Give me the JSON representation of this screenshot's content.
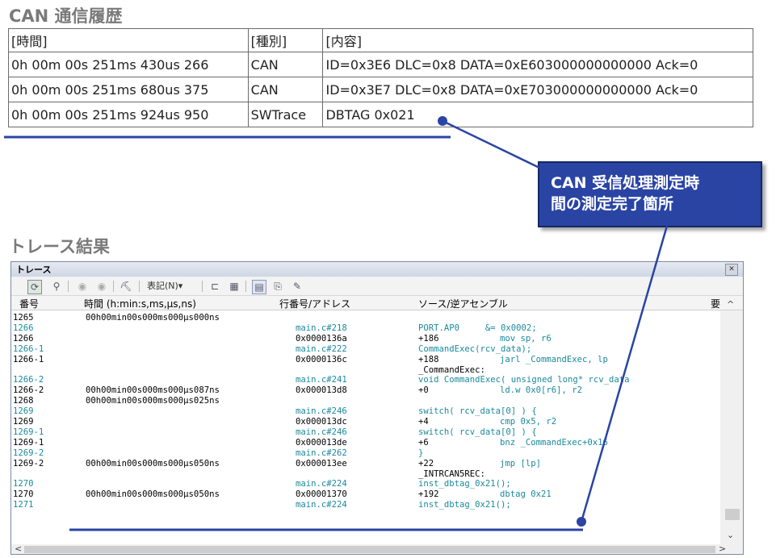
{
  "can_section": {
    "title": "CAN 通信履歴",
    "headers": [
      "[時間]",
      "[種別]",
      "[内容]"
    ],
    "rows": [
      [
        "0h 00m 00s 251ms 430us 266",
        "CAN",
        "ID=0x3E6 DLC=0x8 DATA=0xE603000000000000 Ack=0"
      ],
      [
        "0h 00m 00s 251ms 680us 375",
        "CAN",
        "ID=0x3E7 DLC=0x8 DATA=0xE703000000000000 Ack=0"
      ],
      [
        "0h 00m 00s 251ms 924us 950",
        "SWTrace",
        "DBTAG 0x021"
      ]
    ]
  },
  "callout": {
    "line1": "CAN 受信処理測定時",
    "line2": "間の測定完了箇所",
    "color": "#2a44a4"
  },
  "trace_section": {
    "title": "トレース結果",
    "window_title": "トレース",
    "toolbar": {
      "display_menu": "表記(N)▾"
    },
    "columns": [
      "番号",
      "時間 (h:min:s,ms,μs,ns)",
      "行番号/アドレス",
      "ソース/逆アセンブル",
      "要"
    ],
    "rows": [
      {
        "no": "1265",
        "time": "00h00min00s000ms000μs000ns",
        "addr": "",
        "op": "",
        "mn": "",
        "style": "blk"
      },
      {
        "no": "1266",
        "time": "",
        "addr": "main.c#218",
        "op": "PORT.AP0     &= 0x0002;",
        "mn": "",
        "style": "blue"
      },
      {
        "no": "1266",
        "time": "",
        "addr": "0x0000136a",
        "op": "+186",
        "mn": "mov sp, r6",
        "style": "blk"
      },
      {
        "no": "1266-1",
        "time": "",
        "addr": "main.c#222",
        "op": "CommandExec(rcv_data);",
        "mn": "",
        "style": "blue"
      },
      {
        "no": "1266-1",
        "time": "",
        "addr": "0x0000136c",
        "op": "+188",
        "mn": "jarl _CommandExec, lp",
        "style": "blk"
      },
      {
        "no": "",
        "time": "",
        "addr": "",
        "op": "_CommandExec:",
        "mn": "",
        "style": "blk"
      },
      {
        "no": "1266-2",
        "time": "",
        "addr": "main.c#241",
        "op": "void CommandExec( unsigned long* rcv_data",
        "mn": "",
        "style": "blue"
      },
      {
        "no": "1266-2",
        "time": "00h00min00s000ms000μs087ns",
        "addr": "0x000013d8",
        "op": "+0",
        "mn": "ld.w 0x0[r6], r2",
        "style": "blk"
      },
      {
        "no": "1268",
        "time": "00h00min00s000ms000μs025ns",
        "addr": "",
        "op": "",
        "mn": "",
        "style": "blk"
      },
      {
        "no": "1269",
        "time": "",
        "addr": "main.c#246",
        "op": "switch( rcv_data[0] ) {",
        "mn": "",
        "style": "blue"
      },
      {
        "no": "1269",
        "time": "",
        "addr": "0x000013dc",
        "op": "+4",
        "mn": "cmp 0x5, r2",
        "style": "blk"
      },
      {
        "no": "1269-1",
        "time": "",
        "addr": "main.c#246",
        "op": "switch( rcv_data[0] ) {",
        "mn": "",
        "style": "blue"
      },
      {
        "no": "1269-1",
        "time": "",
        "addr": "0x000013de",
        "op": "+6",
        "mn": "bnz _CommandExec+0x16",
        "style": "blk"
      },
      {
        "no": "1269-2",
        "time": "",
        "addr": "main.c#262",
        "op": "}",
        "mn": "",
        "style": "blue"
      },
      {
        "no": "1269-2",
        "time": "00h00min00s000ms000μs050ns",
        "addr": "0x000013ee",
        "op": "+22",
        "mn": "jmp [lp]",
        "style": "blk"
      },
      {
        "no": "",
        "time": "",
        "addr": "",
        "op": "_INTRCAN5REC:",
        "mn": "",
        "style": "blk"
      },
      {
        "no": "1270",
        "time": "",
        "addr": "main.c#224",
        "op": "inst_dbtag_0x21();",
        "mn": "",
        "style": "blue"
      },
      {
        "no": "1270",
        "time": "00h00min00s000ms000μs050ns",
        "addr": "0x00001370",
        "op": "+192",
        "mn": "dbtag 0x21",
        "style": "blk"
      },
      {
        "no": "1271",
        "time": "",
        "addr": "main.c#224",
        "op": "inst_dbtag_0x21();",
        "mn": "",
        "style": "blue"
      }
    ]
  },
  "colors": {
    "accent_line": "#2a44a4",
    "source_text": "#1a8a9c"
  }
}
